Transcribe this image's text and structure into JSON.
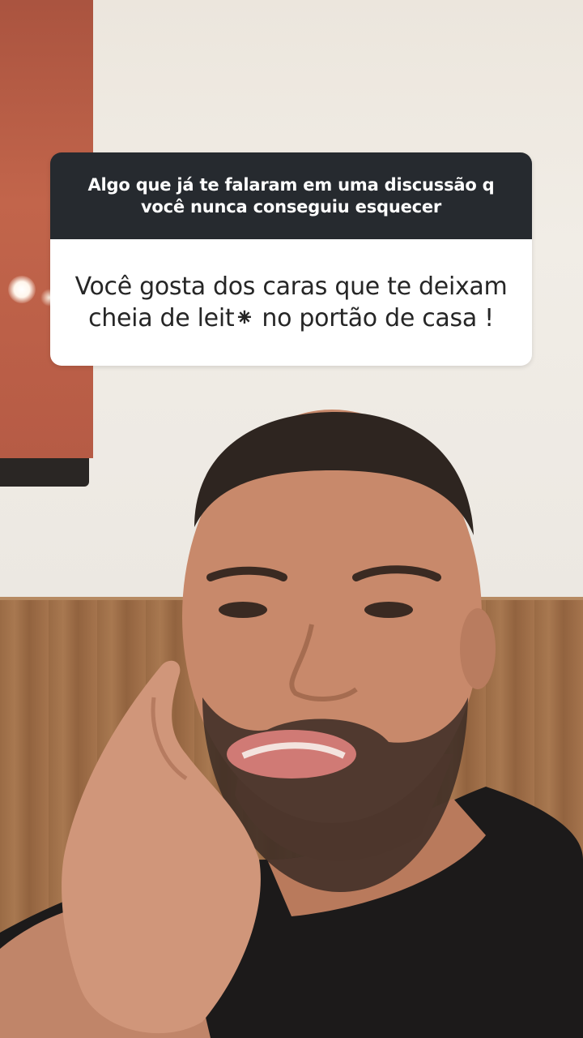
{
  "story": {
    "question_sticker": {
      "question": "Algo que já te falaram em uma discussão q você nunca conseguiu esquecer",
      "answer_line1": "Você gosta dos caras que te deixam",
      "answer_line2": "cheia de leit⁕ no portão de casa !"
    },
    "background": {
      "description_icon": "person-photo"
    }
  },
  "colors": {
    "sticker_header": "#262a2f",
    "sticker_body": "#ffffff",
    "question_text": "#ffffff",
    "answer_text": "#262626"
  }
}
